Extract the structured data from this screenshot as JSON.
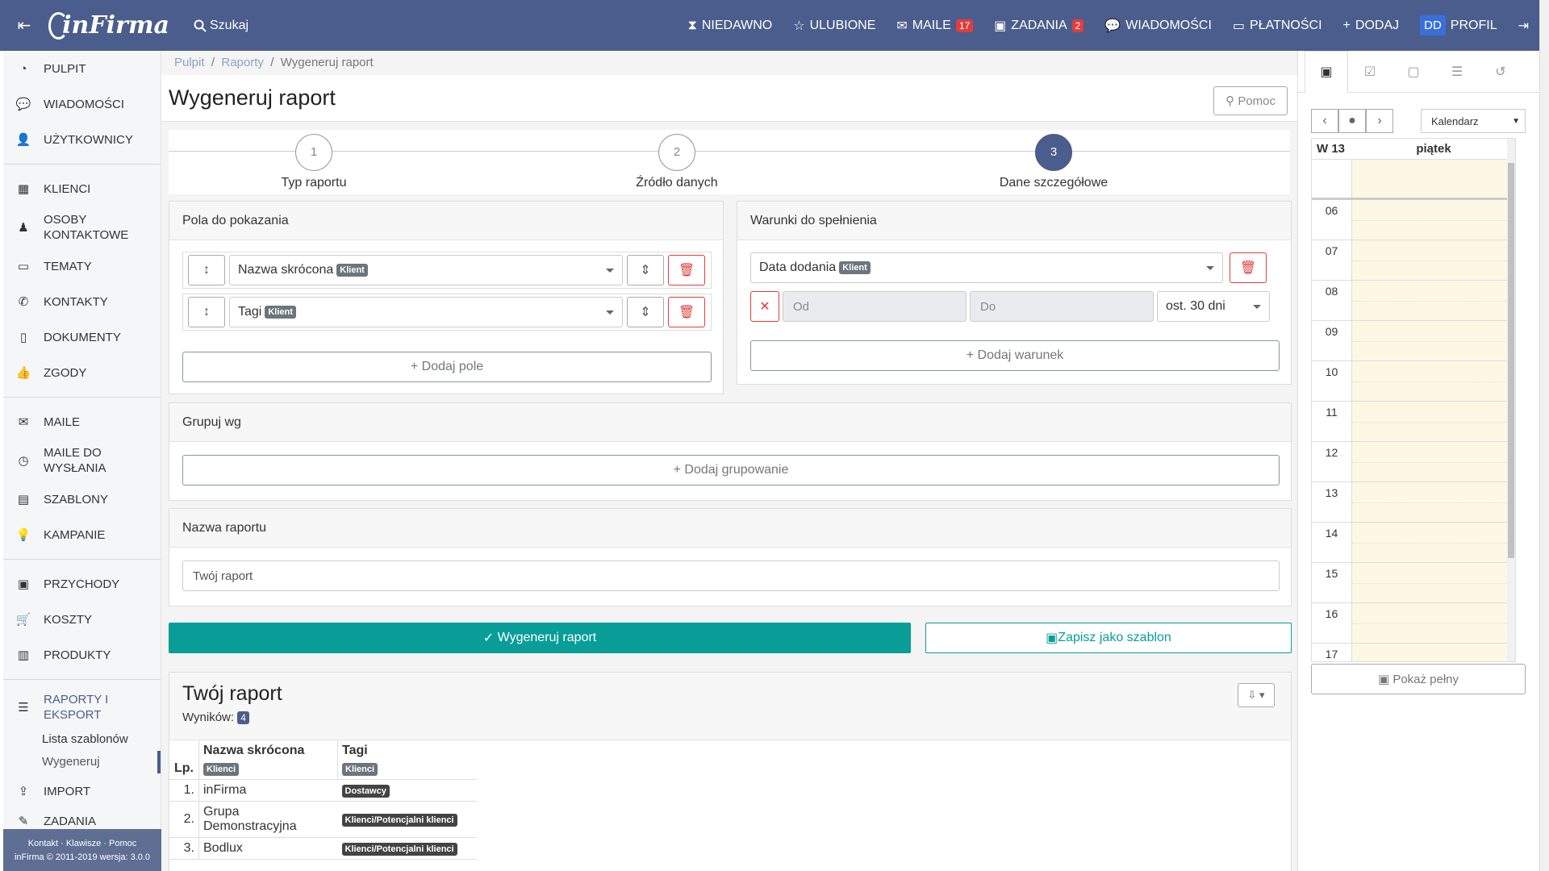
{
  "topbar": {
    "logo": "inFirma",
    "search_label": "Szukaj",
    "nav": [
      {
        "label": "NIEDAWNO",
        "icon": "hourglass-icon"
      },
      {
        "label": "ULUBIONE",
        "icon": "star-icon"
      },
      {
        "label": "MAILE",
        "icon": "mail-icon",
        "badge": "17"
      },
      {
        "label": "ZADANIA",
        "icon": "calendar-icon",
        "badge": "2"
      },
      {
        "label": "WIADOMOŚCI",
        "icon": "chat-icon"
      },
      {
        "label": "PŁATNOŚCI",
        "icon": "payment-icon"
      },
      {
        "label": "DODAJ",
        "icon": "plus-icon"
      }
    ],
    "avatar": "DD",
    "profile_label": "PROFIL"
  },
  "sidebar": {
    "items": [
      {
        "label": "PULPIT"
      },
      {
        "label": "WIADOMOŚCI"
      },
      {
        "label": "UŻYTKOWNICY"
      },
      {
        "label": "KLIENCI"
      },
      {
        "label": "OSOBY KONTAKTOWE"
      },
      {
        "label": "TEMATY"
      },
      {
        "label": "KONTAKTY"
      },
      {
        "label": "DOKUMENTY"
      },
      {
        "label": "ZGODY"
      },
      {
        "label": "MAILE"
      },
      {
        "label": "MAILE DO WYSŁANIA"
      },
      {
        "label": "SZABLONY"
      },
      {
        "label": "KAMPANIE"
      },
      {
        "label": "PRZYCHODY"
      },
      {
        "label": "KOSZTY"
      },
      {
        "label": "PRODUKTY"
      },
      {
        "label": "RAPORTY I EKSPORT"
      },
      {
        "label": "IMPORT"
      },
      {
        "label": "ZADANIA"
      }
    ],
    "sub": [
      "Lista szablonów",
      "Wygeneruj"
    ],
    "footer_links": "Kontakt · Klawisze · Pomoc",
    "footer_version": "inFirma © 2011-2019 wersja: 3.0.0"
  },
  "breadcrumb": [
    "Pulpit",
    "Raporty",
    "Wygeneruj raport"
  ],
  "page_title": "Wygeneruj raport",
  "help_button": "Pomoc",
  "steps": [
    {
      "num": "1",
      "label": "Typ raportu"
    },
    {
      "num": "2",
      "label": "Źródło danych"
    },
    {
      "num": "3",
      "label": "Dane szczegółowe"
    }
  ],
  "fields_panel": {
    "title": "Pola do pokazania",
    "fields": [
      {
        "label": "Nazwa skrócona",
        "tag": "Klient"
      },
      {
        "label": "Tagi",
        "tag": "Klient"
      }
    ],
    "add_label": "Dodaj pole"
  },
  "conditions_panel": {
    "title": "Warunki do spełnienia",
    "field": {
      "label": "Data dodania",
      "tag": "Klient"
    },
    "from_placeholder": "Od",
    "to_placeholder": "Do",
    "range": "ost. 30 dni",
    "add_label": "Dodaj warunek"
  },
  "group_panel": {
    "title": "Grupuj wg",
    "add_label": "Dodaj grupowanie"
  },
  "name_panel": {
    "title": "Nazwa raportu",
    "value": "Twój raport"
  },
  "generate_button": "Wygeneruj raport",
  "save_template_button": "Zapisz jako szablon",
  "report": {
    "title": "Twój raport",
    "results_label": "Wyników:",
    "results_count": "4",
    "columns": {
      "lp": "Lp.",
      "name": "Nazwa skrócona",
      "name_tag": "Klienci",
      "tags": "Tagi",
      "tags_tag": "Klienci"
    },
    "rows": [
      {
        "lp": "1.",
        "name": "inFirma",
        "tag": "Dostawcy"
      },
      {
        "lp": "2.",
        "name": "Grupa Demonstracyjna",
        "tag": "Klienci/Potencjalni klienci"
      },
      {
        "lp": "3.",
        "name": "Bodlux",
        "tag": "Klienci/Potencjalni klienci"
      }
    ]
  },
  "calendar": {
    "view_select": "Kalendarz",
    "week": "W 13",
    "day": "piątek",
    "hours": [
      "06",
      "07",
      "08",
      "09",
      "10",
      "11",
      "12",
      "13",
      "14",
      "15",
      "16",
      "17"
    ],
    "show_full": "Pokaż pełny"
  }
}
